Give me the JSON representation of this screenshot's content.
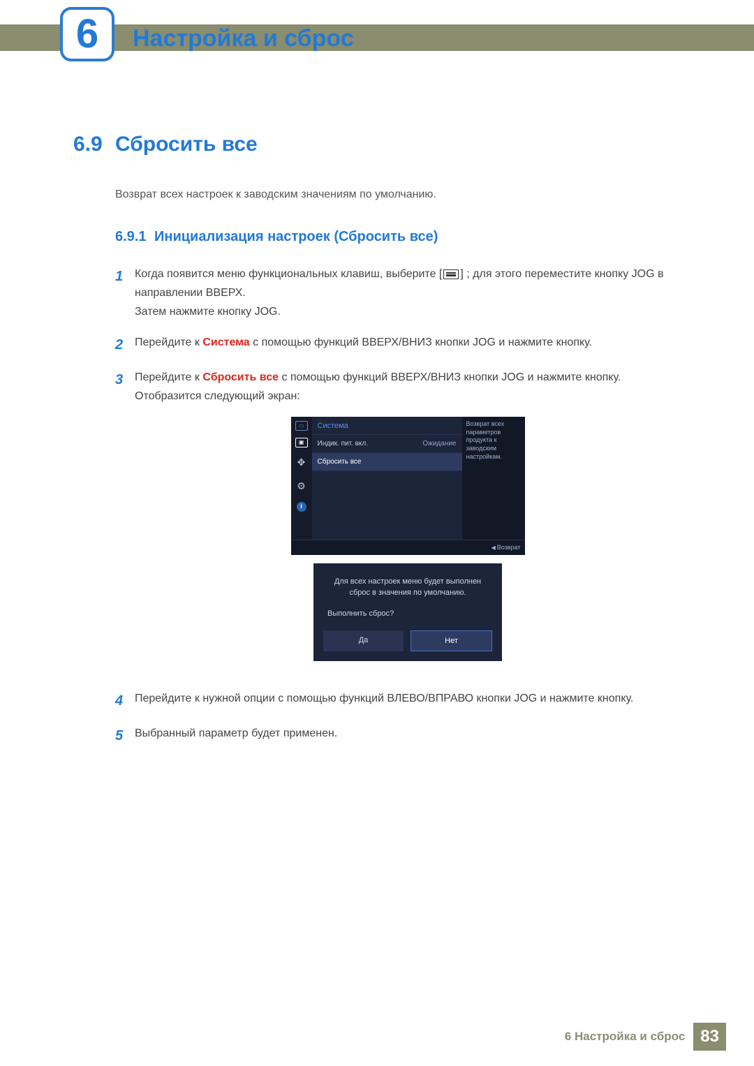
{
  "chapter": {
    "number": "6",
    "title": "Настройка и сброс"
  },
  "section": {
    "num": "6.9",
    "title": "Сбросить все",
    "intro": "Возврат всех настроек к заводским значениям по умолчанию."
  },
  "subsection": {
    "num": "6.9.1",
    "title": "Инициализация настроек (Сбросить все)"
  },
  "steps": {
    "s1a": "Когда появится меню функциональных клавиш, выберите [",
    "s1b": "] ; для этого переместите кнопку JOG в направлении ВВЕРХ.",
    "s1c": "Затем нажмите кнопку JOG.",
    "s2a": "Перейдите к ",
    "s2red": "Система",
    "s2b": " с помощью функций ВВЕРХ/ВНИЗ кнопки JOG и нажмите кнопку.",
    "s3a": "Перейдите к ",
    "s3red": "Сбросить все",
    "s3b": " с помощью функций ВВЕРХ/ВНИЗ кнопки JOG и нажмите кнопку.",
    "s3c": "Отобразится следующий экран:",
    "s4": "Перейдите к нужной опции с помощью функций ВЛЕВО/ВПРАВО кнопки JOG и нажмите кнопку.",
    "s5": "Выбранный параметр будет применен."
  },
  "step_numbers": {
    "n1": "1",
    "n2": "2",
    "n3": "3",
    "n4": "4",
    "n5": "5"
  },
  "osd": {
    "title": "Система",
    "rows": [
      {
        "label": "Индик. пит. вкл.",
        "value": "Ожидание"
      },
      {
        "label": "Сбросить все",
        "value": ""
      }
    ],
    "tooltip": "Возврат всех параметров продукта к заводским настройкам.",
    "footer": "Возврат"
  },
  "dialog": {
    "line1": "Для всех настроек меню будет выполнен",
    "line2": "сброс в значения по умолчанию.",
    "question": "Выполнить сброс?",
    "yes": "Да",
    "no": "Нет"
  },
  "footer": {
    "text": "6 Настройка и сброс",
    "page": "83"
  }
}
